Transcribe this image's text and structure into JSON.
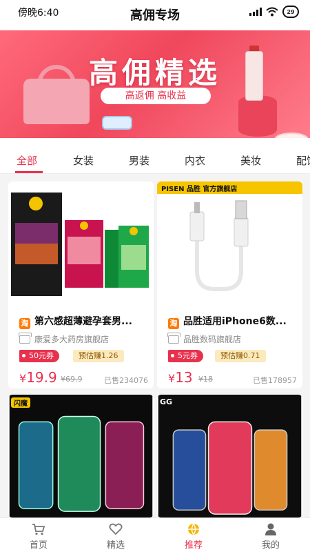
{
  "status": {
    "time": "傍晚6:40",
    "battery": "29"
  },
  "header": {
    "title": "高佣专场"
  },
  "banner": {
    "title": "高佣精选",
    "subtitle": "高返佣  高收益"
  },
  "tabs": [
    {
      "label": "全部",
      "active": true
    },
    {
      "label": "女装"
    },
    {
      "label": "男装"
    },
    {
      "label": "内衣"
    },
    {
      "label": "美妆"
    },
    {
      "label": "配饰"
    }
  ],
  "products": [
    {
      "name": "第六感超薄避孕套男...",
      "shop": "康爱多大药房旗舰店",
      "coupon": "50元券",
      "earn": "预估赚1.26",
      "currency": "¥",
      "price": "19.9",
      "original": "¥69.9",
      "sold": "已售234076"
    },
    {
      "name": "品胜适用iPhone6数...",
      "brand_banner": "PISEN 品胜  官方旗舰店",
      "shop": "品胜数码旗舰店",
      "coupon": "5元券",
      "earn": "预估赚0.71",
      "currency": "¥",
      "price": "13",
      "original": "¥18",
      "sold": "已售178957"
    },
    {
      "badge": "闪魔"
    },
    {
      "badge": "GG"
    }
  ],
  "nav": [
    {
      "label": "首页",
      "icon": "cart-icon"
    },
    {
      "label": "精选",
      "icon": "heart-icon"
    },
    {
      "label": "推荐",
      "icon": "compass-icon",
      "active": true
    },
    {
      "label": "我的",
      "icon": "user-icon"
    }
  ],
  "colors": {
    "accent": "#e8314d",
    "coupon": "#e8314d",
    "earn_bg": "#fde9be",
    "banner": "#f0475c"
  }
}
